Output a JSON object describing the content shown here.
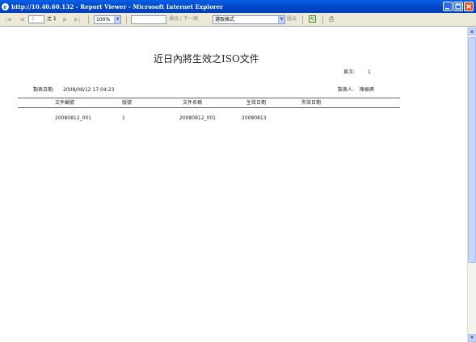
{
  "window": {
    "title": "http://10.40.60.132 - Report Viewer - Microsoft Internet Explorer"
  },
  "toolbar": {
    "first_page": "|◀",
    "prev_page": "◀",
    "page_value": "1",
    "of_text": "之 1",
    "next_page": "▶",
    "last_page": "▶|",
    "zoom_value": "100%",
    "find_label": "尋找",
    "find_separator": "|",
    "find_next_label": "下一個",
    "format_value": "選取格式",
    "export_label": "匯出"
  },
  "report": {
    "title": "近日內將生效之ISO文件",
    "page_label": "頁次:",
    "page_number": "1",
    "created_date_label": "製表日期:",
    "created_date_value": "2008/08/12 17:04:23",
    "created_by_label": "製表人:",
    "created_by_value": "陳振興",
    "columns": [
      "文件編號",
      "版號",
      "文件名稱",
      "生效日期",
      "失效日期"
    ],
    "rows": [
      [
        "20080812_001",
        "1",
        "20080812_001",
        "20080813",
        ""
      ]
    ]
  }
}
